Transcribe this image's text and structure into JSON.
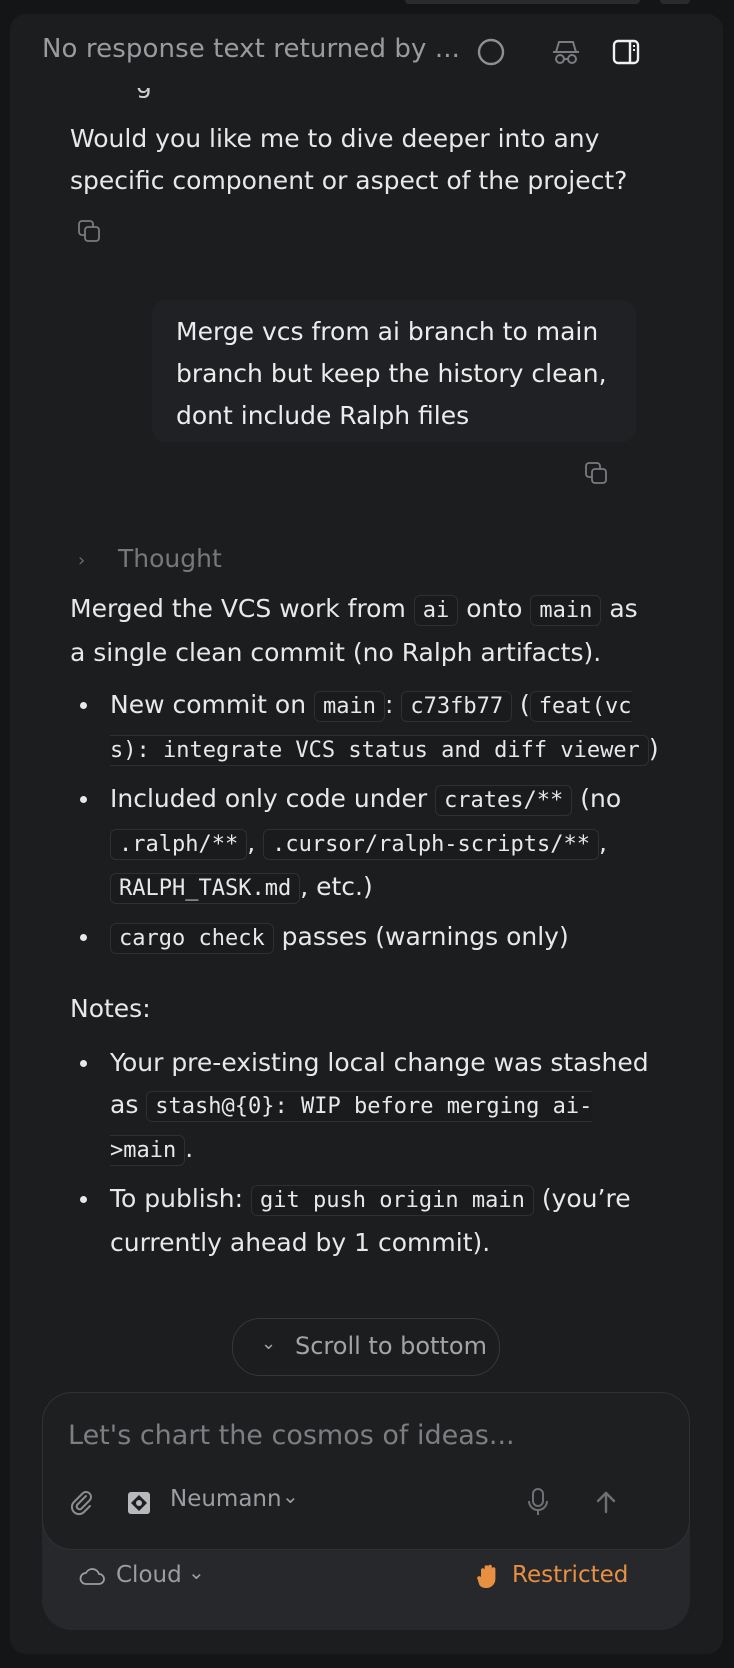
{
  "header": {
    "title": "No response text returned by ..."
  },
  "assistant_prev": {
    "fragment": "g",
    "question": "Would you like me to dive deeper into any specific component or aspect of the project?"
  },
  "user_message": {
    "text": "Merge vcs from ai branch to main branch but keep the history clean, dont include Ralph files"
  },
  "thought": {
    "label": "Thought"
  },
  "response": {
    "intro": {
      "a": "Merged the VCS work from ",
      "code1": "ai",
      "b": " onto ",
      "code2": "main",
      "c": " as a single clean commit (no Ralph artifacts)."
    },
    "bullets": [
      {
        "a": "New commit on ",
        "code1": "main",
        "b": ": ",
        "code2": "c73fb77",
        "c": " (",
        "code3": "feat(vcs): integrate VCS status and diff viewer",
        "d": ")"
      },
      {
        "a": "Included only code under ",
        "code1": "crates/**",
        "b": " (no ",
        "code2": ".ralph/**",
        "c": ", ",
        "code3": ".cursor/ralph-scripts/**",
        "d": ", ",
        "code4": "RALPH_TASK.md",
        "e": ", etc.)"
      },
      {
        "code1": "cargo check",
        "a": " passes (warnings only)"
      }
    ],
    "notes_label": "Notes:",
    "notes": [
      {
        "a": "Your pre-existing local change was stashed as ",
        "code1": "stash@{0}: WIP before merging ai->main",
        "b": "."
      },
      {
        "a": "To publish: ",
        "code1": "git push origin main",
        "b": " (you’re currently ahead by 1 commit)."
      }
    ]
  },
  "scroll_button": {
    "label": "Scroll to bottom"
  },
  "composer": {
    "placeholder": "Let's chart the cosmos of ideas...",
    "model": "Neumann",
    "environment": "Cloud",
    "permission": "Restricted"
  },
  "colors": {
    "background": "#1c1d1f",
    "accent_permission": "#e89042"
  },
  "icons": [
    "circle-icon",
    "incognito-icon",
    "sidebar-toggle-icon",
    "copy-icon",
    "chevron-right-icon",
    "chevron-down-icon",
    "paperclip-icon",
    "model-icon",
    "microphone-icon",
    "arrow-up-icon",
    "cloud-icon",
    "hand-icon"
  ]
}
